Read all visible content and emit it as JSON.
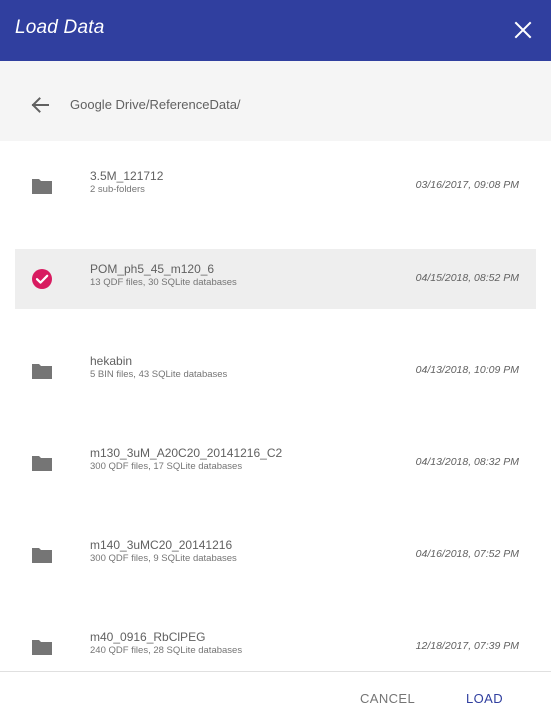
{
  "dialog": {
    "title": "Load Data",
    "close_icon": "close-icon"
  },
  "pathbar": {
    "back_icon": "arrow-left-icon",
    "path": "Google Drive/ReferenceData/"
  },
  "items": [
    {
      "name": "3.5M_121712",
      "detail": "2 sub-folders",
      "date": "03/16/2017, 09:08 PM",
      "selected": false,
      "icon": "folder-icon"
    },
    {
      "name": "POM_ph5_45_m120_6",
      "detail": "13 QDF files, 30 SQLite databases",
      "date": "04/15/2018, 08:52 PM",
      "selected": true,
      "icon": "check-circle-icon"
    },
    {
      "name": "hekabin",
      "detail": "5 BIN files, 43 SQLite databases",
      "date": "04/13/2018, 10:09 PM",
      "selected": false,
      "icon": "folder-icon"
    },
    {
      "name": "m130_3uM_A20C20_20141216_C2",
      "detail": "300 QDF files, 17 SQLite databases",
      "date": "04/13/2018, 08:32 PM",
      "selected": false,
      "icon": "folder-icon"
    },
    {
      "name": "m140_3uMC20_20141216",
      "detail": "300 QDF files, 9 SQLite databases",
      "date": "04/16/2018, 07:52 PM",
      "selected": false,
      "icon": "folder-icon"
    },
    {
      "name": "m40_0916_RbClPEG",
      "detail": "240 QDF files, 28 SQLite databases",
      "date": "12/18/2017, 07:39 PM",
      "selected": false,
      "icon": "folder-icon"
    }
  ],
  "footer": {
    "cancel_label": "CANCEL",
    "load_label": "LOAD"
  },
  "colors": {
    "header": "#303f9f",
    "selected_check": "#d81b60",
    "folder": "#757575",
    "selected_row": "#eeeeee"
  }
}
